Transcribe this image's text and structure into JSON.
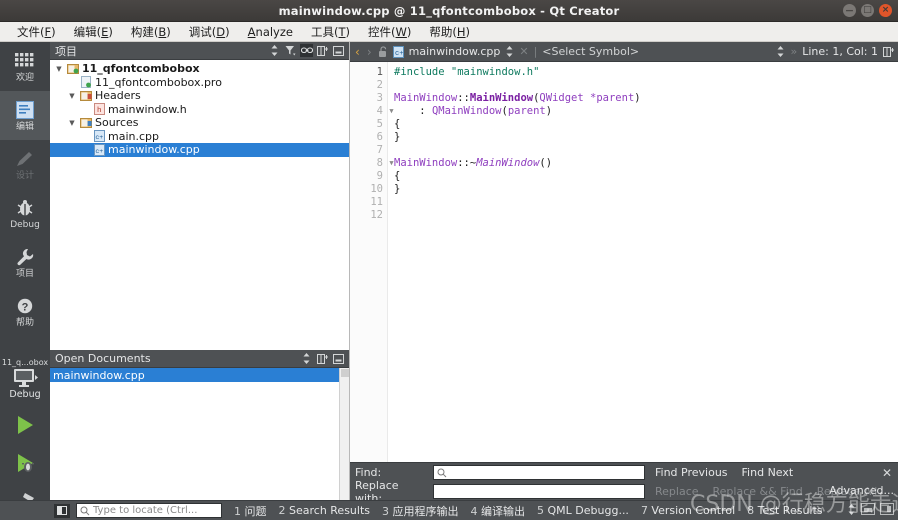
{
  "window": {
    "title": "mainwindow.cpp @ 11_qfontcombobox - Qt Creator",
    "controls": {
      "minimize": "minimize-button",
      "maximize": "maximize-button",
      "close_glyph": "×"
    }
  },
  "menubar": {
    "items": [
      {
        "name": "file",
        "pre": "文件(",
        "key": "F",
        "post": ")"
      },
      {
        "name": "edit",
        "pre": "编辑(",
        "key": "E",
        "post": ")"
      },
      {
        "name": "build",
        "pre": "构建(",
        "key": "B",
        "post": ")"
      },
      {
        "name": "debug",
        "pre": "调试(",
        "key": "D",
        "post": ")"
      },
      {
        "name": "analyze",
        "pre": "",
        "key": "A",
        "post": "nalyze"
      },
      {
        "name": "tools",
        "pre": "工具(",
        "key": "T",
        "post": ")"
      },
      {
        "name": "window",
        "pre": "控件(",
        "key": "W",
        "post": ")"
      },
      {
        "name": "help",
        "pre": "帮助(",
        "key": "H",
        "post": ")"
      }
    ]
  },
  "modebar": {
    "modes": [
      {
        "label": "欢迎",
        "icon": "grid-icon",
        "state": "normal"
      },
      {
        "label": "编辑",
        "icon": "edit-icon",
        "state": "active"
      },
      {
        "label": "设计",
        "icon": "pencil-icon",
        "state": "disabled"
      },
      {
        "label": "Debug",
        "icon": "bug-icon",
        "state": "normal"
      },
      {
        "label": "项目",
        "icon": "wrench-icon",
        "state": "normal"
      },
      {
        "label": "帮助",
        "icon": "help-icon",
        "state": "normal"
      }
    ],
    "kit": {
      "project": "11_q...obox",
      "build_config": "Debug",
      "icon": "monitor-icon"
    },
    "actions": [
      {
        "name": "run-button",
        "icon": "play-icon"
      },
      {
        "name": "debug-run-button",
        "icon": "play-bug-icon"
      },
      {
        "name": "build-button",
        "icon": "hammer-icon"
      }
    ]
  },
  "project_pane": {
    "title": "项目",
    "header_buttons": [
      {
        "name": "filter-sort-button",
        "icon": "up-down-arrows-icon"
      },
      {
        "name": "filter-button",
        "icon": "funnel-icon"
      },
      {
        "name": "sync-editor-button",
        "icon": "link-icon",
        "selected": true
      },
      {
        "name": "split-button",
        "icon": "split-icon"
      },
      {
        "name": "close-panel-button",
        "icon": "minimize-panel-icon"
      }
    ],
    "tree": [
      {
        "name": "project-root",
        "label": "11_qfontcombobox",
        "indent": 0,
        "arrow": "down",
        "icon": "qt-project-icon",
        "bold": true,
        "selected": false
      },
      {
        "name": "pro-file",
        "label": "11_qfontcombobox.pro",
        "indent": 1,
        "arrow": "",
        "icon": "pro-file-icon",
        "bold": false,
        "selected": false
      },
      {
        "name": "headers-folder",
        "label": "Headers",
        "indent": 1,
        "arrow": "down",
        "icon": "headers-folder-icon",
        "bold": false,
        "selected": false
      },
      {
        "name": "mainwindow-h",
        "label": "mainwindow.h",
        "indent": 2,
        "arrow": "",
        "icon": "h-file-icon",
        "bold": false,
        "selected": false
      },
      {
        "name": "sources-folder",
        "label": "Sources",
        "indent": 1,
        "arrow": "down",
        "icon": "sources-folder-icon",
        "bold": false,
        "selected": false
      },
      {
        "name": "main-cpp",
        "label": "main.cpp",
        "indent": 2,
        "arrow": "",
        "icon": "cpp-file-icon",
        "bold": false,
        "selected": false
      },
      {
        "name": "mainwindow-cpp",
        "label": "mainwindow.cpp",
        "indent": 2,
        "arrow": "",
        "icon": "cpp-file-icon",
        "bold": false,
        "selected": true
      }
    ]
  },
  "open_documents": {
    "title": "Open Documents",
    "header_buttons": [
      {
        "name": "sort-button",
        "icon": "up-down-arrows-icon"
      },
      {
        "name": "split-button",
        "icon": "split-icon"
      },
      {
        "name": "close-panel-button",
        "icon": "minimize-panel-icon"
      }
    ],
    "items": [
      {
        "name": "open-doc-mainwindow-cpp",
        "label": "mainwindow.cpp",
        "selected": true
      }
    ]
  },
  "editor": {
    "toolbar": {
      "back": "‹",
      "forward": "›",
      "lock_icon": "unlock-icon",
      "file_icon": "cpp-file-icon",
      "filename": "mainwindow.cpp",
      "close_glyph": "✕",
      "symbol_selector": "<Select Symbol>",
      "cursor_position": "Line: 1, Col: 1",
      "split_icon": "split-icon"
    },
    "line_numbers": [
      "1",
      "2",
      "3",
      "4",
      "5",
      "6",
      "7",
      "8",
      "9",
      "10",
      "11",
      "12"
    ],
    "fold_markers": {
      "4": "▼",
      "8": "▼"
    },
    "lines": [
      {
        "n": 1,
        "tokens": [
          {
            "t": "pre",
            "s": "#include "
          },
          {
            "t": "str",
            "s": "\"mainwindow.h\""
          }
        ]
      },
      {
        "n": 2,
        "tokens": []
      },
      {
        "n": 3,
        "tokens": [
          {
            "t": "type",
            "s": "MainWindow"
          },
          {
            "t": "plain",
            "s": "::"
          },
          {
            "t": "typeb",
            "s": "MainWindow"
          },
          {
            "t": "plain",
            "s": "("
          },
          {
            "t": "type",
            "s": "QWidget"
          },
          {
            "t": "plain",
            "s": " "
          },
          {
            "t": "type",
            "s": "*parent"
          },
          {
            "t": "plain",
            "s": ")"
          }
        ]
      },
      {
        "n": 4,
        "tokens": [
          {
            "t": "plain",
            "s": "    : "
          },
          {
            "t": "type",
            "s": "QMainWindow"
          },
          {
            "t": "plain",
            "s": "("
          },
          {
            "t": "type",
            "s": "parent"
          },
          {
            "t": "plain",
            "s": ")"
          }
        ]
      },
      {
        "n": 5,
        "tokens": [
          {
            "t": "plain",
            "s": "{"
          }
        ]
      },
      {
        "n": 6,
        "tokens": [
          {
            "t": "plain",
            "s": "}"
          }
        ]
      },
      {
        "n": 7,
        "tokens": []
      },
      {
        "n": 8,
        "tokens": [
          {
            "t": "type",
            "s": "MainWindow"
          },
          {
            "t": "plain",
            "s": "::~"
          },
          {
            "t": "typei",
            "s": "MainWindow"
          },
          {
            "t": "plain",
            "s": "()"
          }
        ]
      },
      {
        "n": 9,
        "tokens": [
          {
            "t": "plain",
            "s": "{"
          }
        ]
      },
      {
        "n": 10,
        "tokens": [
          {
            "t": "plain",
            "s": "}"
          }
        ]
      },
      {
        "n": 11,
        "tokens": []
      },
      {
        "n": 12,
        "tokens": []
      }
    ]
  },
  "find_bar": {
    "find_label": "Find:",
    "find_value": "",
    "find_icon": "search-icon",
    "replace_label": "Replace with:",
    "replace_value": "",
    "find_previous": "Find Previous",
    "find_next": "Find Next",
    "replace": "Replace",
    "replace_find": "Replace && Find",
    "replace_all": "Replace All",
    "advanced": "Advanced...",
    "close_glyph": "✕"
  },
  "statusbar": {
    "sidebar_toggle": "sidebar-toggle-icon",
    "locator_placeholder": "Type to locate (Ctrl...",
    "locator_icon": "search-icon",
    "panes": [
      {
        "num": "1",
        "label": "问题"
      },
      {
        "num": "2",
        "label": "Search Results"
      },
      {
        "num": "3",
        "label": "应用程序输出"
      },
      {
        "num": "4",
        "label": "编译输出"
      },
      {
        "num": "5",
        "label": "QML Debugg..."
      },
      {
        "num": "7",
        "label": "Version Control"
      },
      {
        "num": "8",
        "label": "Test Results"
      }
    ],
    "right_buttons": [
      {
        "name": "output-size-button",
        "icon": "up-down-arrows-icon"
      },
      {
        "name": "maximize-output-button",
        "icon": "panel-bottom-icon"
      },
      {
        "name": "right-sidebar-button",
        "icon": "panel-right-icon"
      }
    ]
  },
  "watermark": {
    "text": "CSDN @行稳方能走远"
  },
  "colors": {
    "accent_selection": "#2a7fd4",
    "chrome_dark": "#4e5154",
    "mode_bar": "#3f4245",
    "close_button": "#e0552a",
    "keyword_green": "#0e7a5f",
    "type_purple": "#8f3fbf"
  }
}
